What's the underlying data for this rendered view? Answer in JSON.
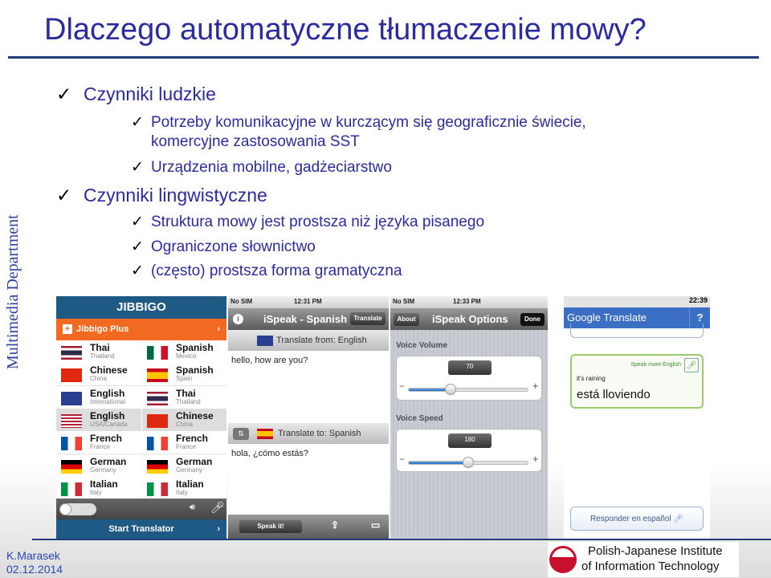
{
  "slide": {
    "title": "Dlaczego automatyczne tłumaczenie mowy?",
    "side_label": "Multimedia Department",
    "bullets": [
      {
        "level": 1,
        "text": "Czynniki ludzkie"
      },
      {
        "level": 2,
        "text": "Potrzeby komunikacyjne w kurczącym się geograficznie świecie,"
      },
      {
        "level": 2,
        "text": "komercyjne zastosowania SST",
        "continuation": true
      },
      {
        "level": 2,
        "text": "Urządzenia mobilne, gadżeciarstwo"
      },
      {
        "level": 1,
        "text": "Czynniki lingwistyczne"
      },
      {
        "level": 2,
        "text": "Struktura mowy jest prostsza niż języka pisanego"
      },
      {
        "level": 2,
        "text": "Ograniczone słownictwo"
      },
      {
        "level": 2,
        "text": "(często) prostsza forma gramatyczna"
      }
    ],
    "check_glyph": "✓"
  },
  "jibbigo": {
    "logo": "JIBBIGO",
    "plus": "Jibbigo Plus",
    "start": "Start Translator",
    "left": [
      {
        "lang": "Thai",
        "country": "Thailand",
        "flag": "th"
      },
      {
        "lang": "Chinese",
        "country": "China",
        "flag": "cn"
      },
      {
        "lang": "English",
        "country": "International",
        "flag": "uk"
      },
      {
        "lang": "English",
        "country": "USA/Canada",
        "flag": "us"
      },
      {
        "lang": "French",
        "country": "France",
        "flag": "fr"
      },
      {
        "lang": "German",
        "country": "Germany",
        "flag": "de"
      },
      {
        "lang": "Italian",
        "country": "Italy",
        "flag": "it"
      }
    ],
    "right": [
      {
        "lang": "Spanish",
        "country": "Mexico",
        "flag": "mx"
      },
      {
        "lang": "Spanish",
        "country": "Spain",
        "flag": "es"
      },
      {
        "lang": "Thai",
        "country": "Thailand",
        "flag": "th"
      },
      {
        "lang": "Chinese",
        "country": "China",
        "flag": "cn"
      },
      {
        "lang": "French",
        "country": "France",
        "flag": "fr"
      },
      {
        "lang": "German",
        "country": "Germany",
        "flag": "de"
      },
      {
        "lang": "Italian",
        "country": "Italy",
        "flag": "it"
      }
    ]
  },
  "ispeak": {
    "carrier": "No SIM",
    "time": "12:31 PM",
    "title": "iSpeak - Spanish",
    "translate_btn": "Translate",
    "from": "Translate from: English",
    "input": "hello, how are you?",
    "to": "Translate to: Spanish",
    "output": "hola, ¿cómo estás?",
    "speak": "Speak it!"
  },
  "options": {
    "carrier": "No SIM",
    "time": "12:33 PM",
    "title": "iSpeak Options",
    "about": "About",
    "done": "Done",
    "volume_label": "Voice Volume",
    "volume": "70",
    "volume_level": 0.35,
    "speed_label": "Voice Speed",
    "speed": "180",
    "speed_level": 0.5
  },
  "google": {
    "time": "22:39",
    "title": "Google Translate",
    "help": "?",
    "speak_more": "Speak more English",
    "source": "it's raining",
    "translation": "está lloviendo",
    "respond": "Responder en español"
  },
  "footer": {
    "author": "K.Marasek",
    "date": "02.12.2014",
    "institute_line1": "Polish-Japanese Institute",
    "institute_line2": "of Information Technology"
  },
  "colors": {
    "title": "#2b2ba0",
    "rule": "#1f3d7a",
    "jibbigo_blue": "#1f5a85",
    "jibbigo_orange": "#f26a21",
    "google_blue": "#3b6fc4"
  }
}
